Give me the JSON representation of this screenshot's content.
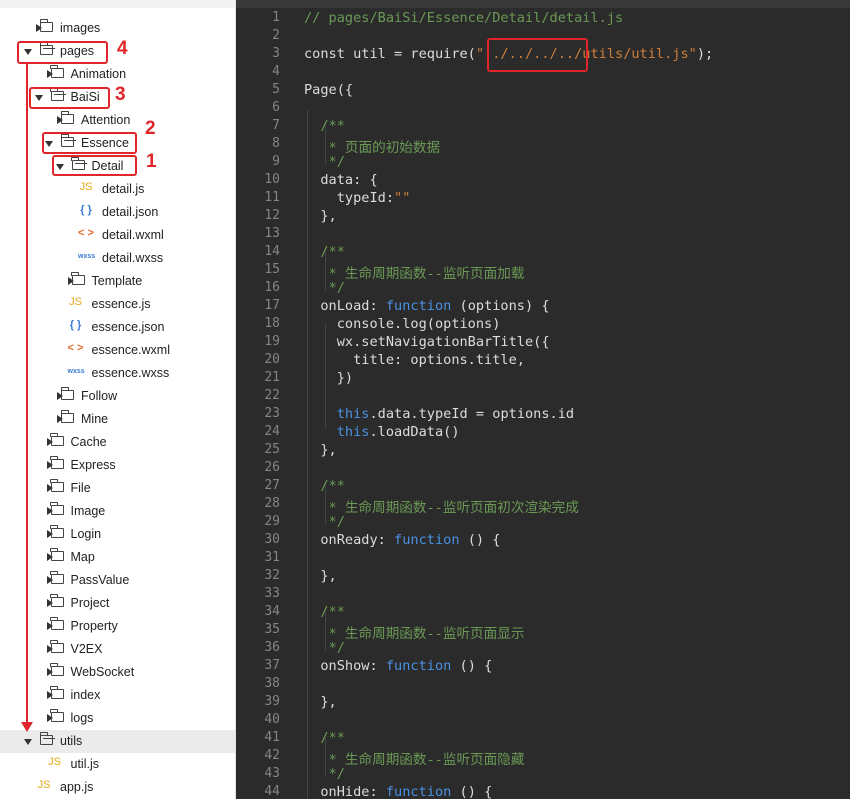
{
  "sidebar": {
    "items": [
      {
        "label": "images",
        "type": "folder",
        "state": "collapsed",
        "depth": 0
      },
      {
        "label": "pages",
        "type": "folder",
        "state": "expanded",
        "depth": 0
      },
      {
        "label": "Animation",
        "type": "folder",
        "state": "collapsed",
        "depth": 1
      },
      {
        "label": "BaiSi",
        "type": "folder",
        "state": "expanded",
        "depth": 1
      },
      {
        "label": "Attention",
        "type": "folder",
        "state": "collapsed",
        "depth": 2
      },
      {
        "label": "Essence",
        "type": "folder",
        "state": "expanded",
        "depth": 2
      },
      {
        "label": "Detail",
        "type": "folder",
        "state": "expanded",
        "depth": 3
      },
      {
        "label": "detail.js",
        "type": "js",
        "depth": 4
      },
      {
        "label": "detail.json",
        "type": "json",
        "depth": 4
      },
      {
        "label": "detail.wxml",
        "type": "wxml",
        "depth": 4
      },
      {
        "label": "detail.wxss",
        "type": "wxss",
        "depth": 4
      },
      {
        "label": "Template",
        "type": "folder",
        "state": "collapsed",
        "depth": 3
      },
      {
        "label": "essence.js",
        "type": "js",
        "depth": 3
      },
      {
        "label": "essence.json",
        "type": "json",
        "depth": 3
      },
      {
        "label": "essence.wxml",
        "type": "wxml",
        "depth": 3
      },
      {
        "label": "essence.wxss",
        "type": "wxss",
        "depth": 3
      },
      {
        "label": "Follow",
        "type": "folder",
        "state": "collapsed",
        "depth": 2
      },
      {
        "label": "Mine",
        "type": "folder",
        "state": "collapsed",
        "depth": 2
      },
      {
        "label": "Cache",
        "type": "folder",
        "state": "collapsed",
        "depth": 1
      },
      {
        "label": "Express",
        "type": "folder",
        "state": "collapsed",
        "depth": 1
      },
      {
        "label": "File",
        "type": "folder",
        "state": "collapsed",
        "depth": 1
      },
      {
        "label": "Image",
        "type": "folder",
        "state": "collapsed",
        "depth": 1
      },
      {
        "label": "Login",
        "type": "folder",
        "state": "collapsed",
        "depth": 1
      },
      {
        "label": "Map",
        "type": "folder",
        "state": "collapsed",
        "depth": 1
      },
      {
        "label": "PassValue",
        "type": "folder",
        "state": "collapsed",
        "depth": 1
      },
      {
        "label": "Project",
        "type": "folder",
        "state": "collapsed",
        "depth": 1
      },
      {
        "label": "Property",
        "type": "folder",
        "state": "collapsed",
        "depth": 1
      },
      {
        "label": "V2EX",
        "type": "folder",
        "state": "collapsed",
        "depth": 1
      },
      {
        "label": "WebSocket",
        "type": "folder",
        "state": "collapsed",
        "depth": 1
      },
      {
        "label": "index",
        "type": "folder",
        "state": "collapsed",
        "depth": 1
      },
      {
        "label": "logs",
        "type": "folder",
        "state": "collapsed",
        "depth": 1
      },
      {
        "label": "utils",
        "type": "folder",
        "state": "expanded",
        "depth": 0,
        "selected": true
      },
      {
        "label": "util.js",
        "type": "js",
        "depth": 1
      },
      {
        "label": "app.js",
        "type": "js",
        "depth": 0
      }
    ],
    "icons": {
      "js": "JS",
      "json": "{ }",
      "wxml": "< >",
      "wxss": "wxss"
    },
    "annotations": [
      "1",
      "2",
      "3",
      "4"
    ],
    "annotation_color": "#e0262a"
  },
  "editor": {
    "lines": [
      [
        [
          "c-comment",
          "// pages/BaiSi/Essence/Detail/detail.js"
        ]
      ],
      [],
      [
        [
          "c-plain",
          "const util = require("
        ],
        [
          "c-string",
          "\"../../../../utils/util.js\""
        ],
        [
          "c-plain",
          ");"
        ]
      ],
      [],
      [
        [
          "c-plain",
          "Page({"
        ]
      ],
      [],
      [
        [
          "c-comment",
          "  /**"
        ]
      ],
      [
        [
          "c-comment",
          "   * 页面的初始数据"
        ]
      ],
      [
        [
          "c-comment",
          "   */"
        ]
      ],
      [
        [
          "c-plain",
          "  data: {"
        ]
      ],
      [
        [
          "c-plain",
          "    typeId:"
        ],
        [
          "c-string",
          "\"\""
        ]
      ],
      [
        [
          "c-plain",
          "  },"
        ]
      ],
      [],
      [
        [
          "c-comment",
          "  /**"
        ]
      ],
      [
        [
          "c-comment",
          "   * 生命周期函数--监听页面加载"
        ]
      ],
      [
        [
          "c-comment",
          "   */"
        ]
      ],
      [
        [
          "c-plain",
          "  onLoad: "
        ],
        [
          "c-keyword",
          "function"
        ],
        [
          "c-plain",
          " (options) {"
        ]
      ],
      [
        [
          "c-plain",
          "    console.log(options)"
        ]
      ],
      [
        [
          "c-plain",
          "    wx.setNavigationBarTitle({"
        ]
      ],
      [
        [
          "c-plain",
          "      title: options.title,"
        ]
      ],
      [
        [
          "c-plain",
          "    })"
        ]
      ],
      [],
      [
        [
          "c-plain",
          "    "
        ],
        [
          "c-this",
          "this"
        ],
        [
          "c-plain",
          ".data.typeId = options.id"
        ]
      ],
      [
        [
          "c-plain",
          "    "
        ],
        [
          "c-this",
          "this"
        ],
        [
          "c-plain",
          ".loadData()"
        ]
      ],
      [
        [
          "c-plain",
          "  },"
        ]
      ],
      [],
      [
        [
          "c-comment",
          "  /**"
        ]
      ],
      [
        [
          "c-comment",
          "   * 生命周期函数--监听页面初次渲染完成"
        ]
      ],
      [
        [
          "c-comment",
          "   */"
        ]
      ],
      [
        [
          "c-plain",
          "  onReady: "
        ],
        [
          "c-keyword",
          "function"
        ],
        [
          "c-plain",
          " () {"
        ]
      ],
      [],
      [
        [
          "c-plain",
          "  },"
        ]
      ],
      [],
      [
        [
          "c-comment",
          "  /**"
        ]
      ],
      [
        [
          "c-comment",
          "   * 生命周期函数--监听页面显示"
        ]
      ],
      [
        [
          "c-comment",
          "   */"
        ]
      ],
      [
        [
          "c-plain",
          "  onShow: "
        ],
        [
          "c-keyword",
          "function"
        ],
        [
          "c-plain",
          " () {"
        ]
      ],
      [],
      [
        [
          "c-plain",
          "  },"
        ]
      ],
      [],
      [
        [
          "c-comment",
          "  /**"
        ]
      ],
      [
        [
          "c-comment",
          "   * 生命周期函数--监听页面隐藏"
        ]
      ],
      [
        [
          "c-comment",
          "   */"
        ]
      ],
      [
        [
          "c-plain",
          "  onHide: "
        ],
        [
          "c-keyword",
          "function"
        ],
        [
          "c-plain",
          " () {"
        ]
      ]
    ],
    "colors": {
      "background": "#2b2b2b",
      "comment": "#6a9955",
      "keyword": "#4a90e2",
      "string": "#ce7f3c",
      "text": "#dcdcdc",
      "line_number": "#858585"
    }
  }
}
